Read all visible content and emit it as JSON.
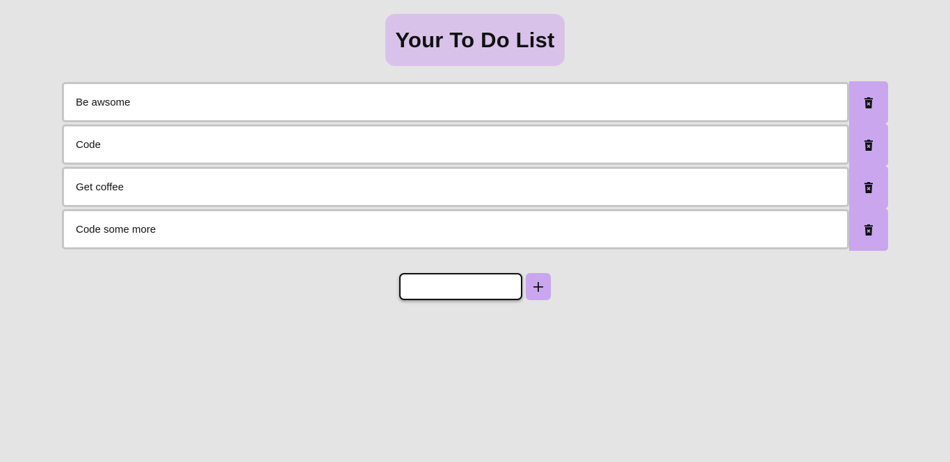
{
  "header": {
    "title": "Your To Do List"
  },
  "todos": [
    {
      "text": "Be awsome",
      "delete_icon": "trash-x-icon"
    },
    {
      "text": "Code",
      "delete_icon": "trash-x-icon"
    },
    {
      "text": "Get coffee",
      "delete_icon": "trash-x-icon"
    },
    {
      "text": "Code some more",
      "delete_icon": "trash-x-icon"
    }
  ],
  "add_form": {
    "input_value": "",
    "input_placeholder": "",
    "add_icon": "plus-icon"
  },
  "colors": {
    "background": "#e4e4e4",
    "title_bg": "#d8c2ea",
    "accent": "#c9a6ee",
    "item_border": "#c6c6c6"
  }
}
